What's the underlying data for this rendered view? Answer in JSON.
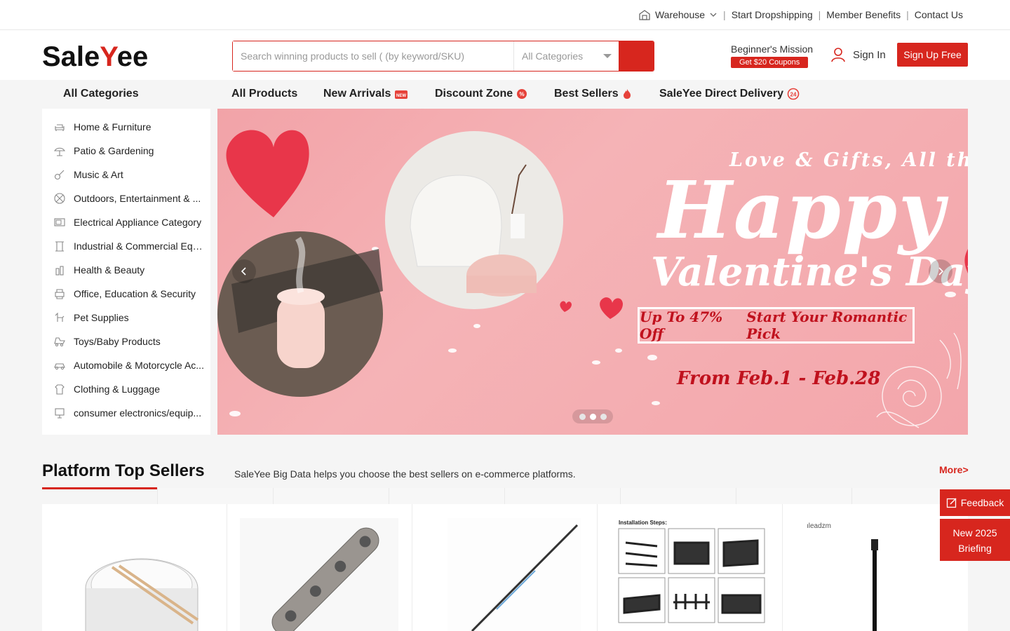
{
  "topbar": {
    "warehouse": "Warehouse",
    "links": [
      "Start Dropshipping",
      "Member Benefits",
      "Contact Us"
    ]
  },
  "header": {
    "logo_prefix": "Sale",
    "logo_y": "Y",
    "logo_suffix": "ee",
    "search_placeholder": "Search winning products to sell ( (by keyword/SKU)",
    "category_select": "All Categories",
    "mission_title": "Beginner's Mission",
    "mission_coupon": "Get $20 Coupons",
    "sign_in": "Sign In",
    "sign_up": "Sign Up Free"
  },
  "nav": {
    "all_categories": "All Categories",
    "items": [
      "All Products",
      "New Arrivals",
      "Discount Zone",
      "Best Sellers",
      "SaleYee Direct Delivery"
    ]
  },
  "sidebar": {
    "items": [
      {
        "label": "Home & Furniture",
        "icon": "sofa-icon"
      },
      {
        "label": "Patio & Gardening",
        "icon": "garden-icon"
      },
      {
        "label": "Music & Art",
        "icon": "guitar-icon"
      },
      {
        "label": "Outdoors, Entertainment & ...",
        "icon": "ball-icon"
      },
      {
        "label": "Electrical Appliance Category",
        "icon": "appliance-icon"
      },
      {
        "label": "Industrial & Commercial Equi...",
        "icon": "industrial-icon"
      },
      {
        "label": "Health & Beauty",
        "icon": "beauty-icon"
      },
      {
        "label": "Office, Education & Security",
        "icon": "printer-icon"
      },
      {
        "label": "Pet Supplies",
        "icon": "pet-icon"
      },
      {
        "label": "Toys/Baby Products",
        "icon": "toy-icon"
      },
      {
        "label": "Automobile & Motorcycle Ac...",
        "icon": "car-icon"
      },
      {
        "label": "Clothing & Luggage",
        "icon": "clothing-icon"
      },
      {
        "label": "consumer electronics/equip...",
        "icon": "electronics-icon"
      }
    ]
  },
  "banner": {
    "tagline": "Love & Gifts, All the W",
    "headline": "Happy",
    "subheadline": "Valentine's Day",
    "offer": "Up To 47% Off",
    "cta": "Start Your Romantic Pick",
    "dates": "From Feb.1 - Feb.28",
    "active_slide": 2,
    "slide_count": 3
  },
  "section": {
    "title": "Platform Top Sellers",
    "subtitle": "SaleYee Big Data helps you choose the best sellers on e-commerce platforms.",
    "more": "More>"
  },
  "products": {
    "brand_label": "ıleadzm",
    "installation_label": "Installation Steps:"
  },
  "floating": {
    "feedback": "Feedback",
    "briefing_line1": "New 2025",
    "briefing_line2": "Briefing"
  },
  "colors": {
    "accent": "#d7261e",
    "banner_bg": "#f3a9ad"
  }
}
